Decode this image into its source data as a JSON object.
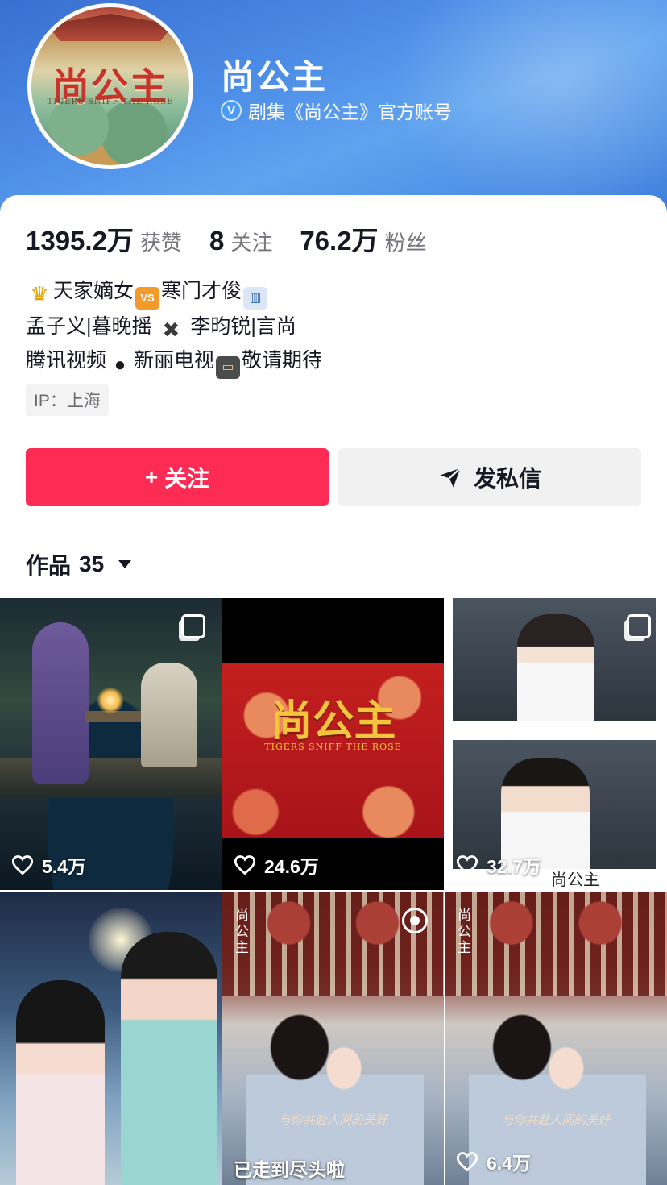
{
  "profile": {
    "name": "尚公主",
    "verify_text": "剧集《尚公主》官方账号",
    "avatar_logo": "尚公主",
    "avatar_subtitle": "TIGERS SNIFF THE ROSE"
  },
  "stats": [
    {
      "value": "1395.2万",
      "label": "获赞"
    },
    {
      "value": "8",
      "label": "关注"
    },
    {
      "value": "76.2万",
      "label": "粉丝"
    }
  ],
  "bio": {
    "line1_a": "天家嫡女",
    "line1_vs": "VS",
    "line1_b": "寒门才俊",
    "line2_a": "孟子义|暮晚摇",
    "line2_b": "李昀锐|言尚",
    "line3_a": "腾讯视频",
    "line3_b": "新丽电视",
    "line3_c": "敬请期待"
  },
  "ip_label": "IP：上海",
  "buttons": {
    "follow": "关注",
    "follow_plus": "+",
    "message": "发私信"
  },
  "works": {
    "label": "作品",
    "count": "35"
  },
  "tiles": [
    {
      "likes": "5.4万"
    },
    {
      "likes": "24.6万",
      "logo": "尚公主",
      "subtitle": "TIGERS SNIFF THE ROSE"
    },
    {
      "likes": "32.7万",
      "mark": "尚公主"
    },
    {
      "likes": ""
    },
    {
      "caption": "与你共赴人间的美好",
      "brand": "尚公主"
    },
    {
      "likes": "6.4万",
      "caption": "与你共赴人间的美好",
      "brand": "尚公主"
    }
  ],
  "end_text": "已走到尽头啦",
  "colors": {
    "accent": "#fe2c55",
    "banner": "#4b8be6"
  }
}
